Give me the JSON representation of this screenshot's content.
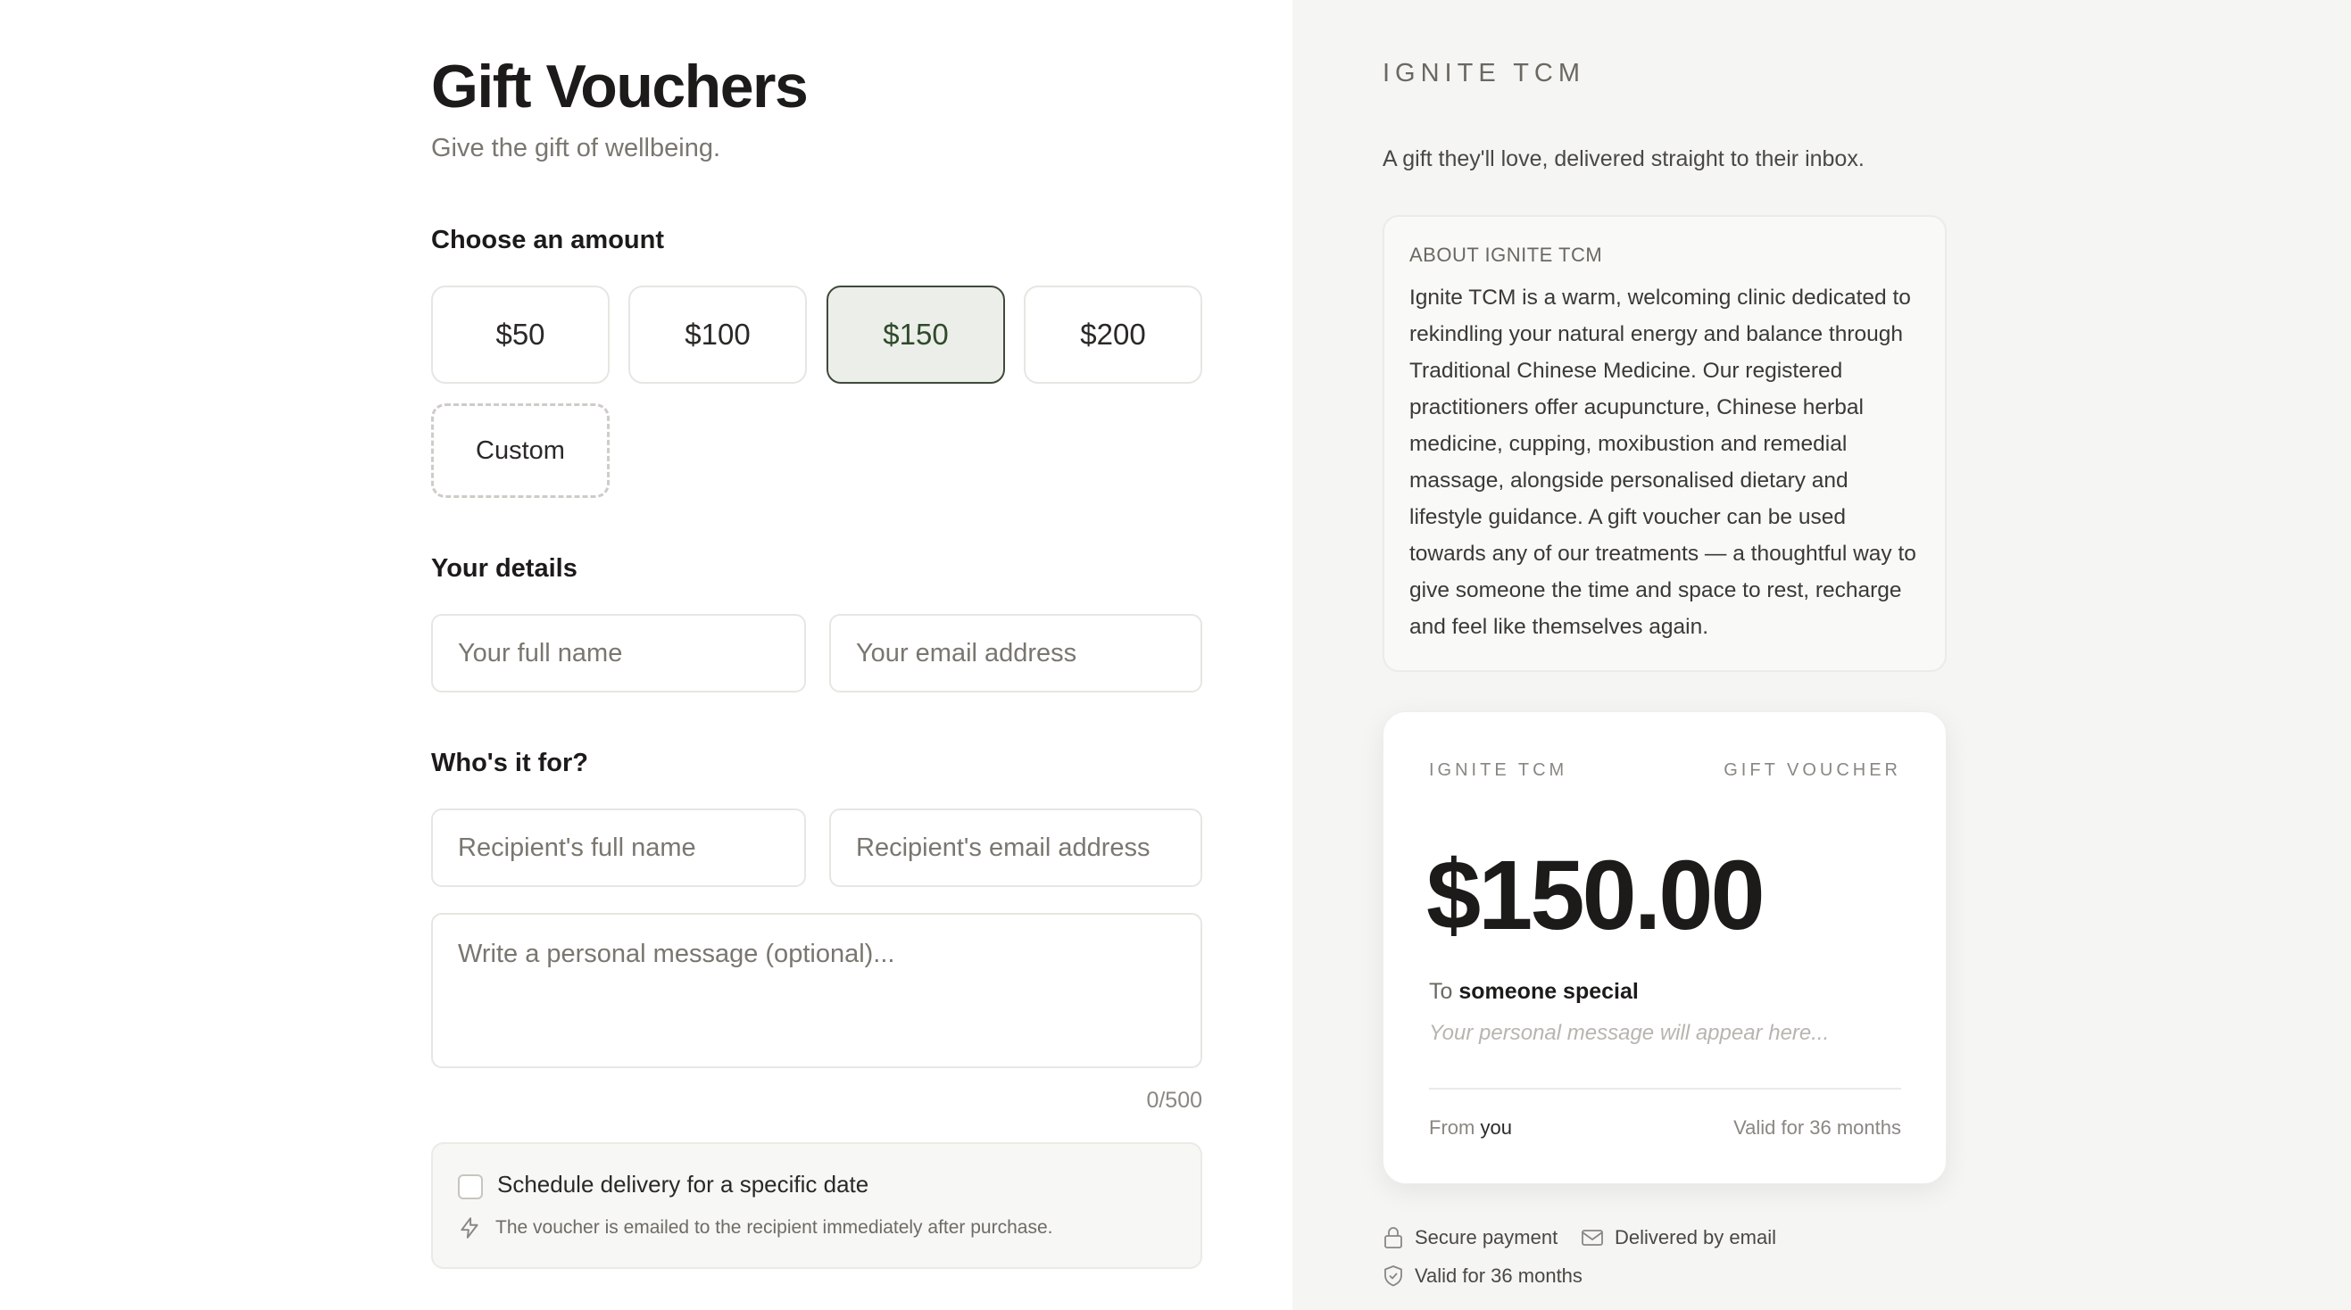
{
  "form": {
    "title": "Gift Vouchers",
    "subtitle": "Give the gift of wellbeing.",
    "amount_heading": "Choose an amount",
    "amounts": [
      "$50",
      "$100",
      "$150",
      "$200"
    ],
    "selected_amount": "$150",
    "custom_label": "Custom",
    "details_heading": "Your details",
    "your_name_placeholder": "Your full name",
    "your_email_placeholder": "Your email address",
    "recipient_heading": "Who's it for?",
    "recipient_name_placeholder": "Recipient's full name",
    "recipient_email_placeholder": "Recipient's email address",
    "message_placeholder": "Write a personal message (optional)...",
    "message_counter": "0/500",
    "schedule_label": "Schedule delivery for a specific date",
    "schedule_checked": false,
    "schedule_note": "The voucher is emailed to the recipient immediately after purchase."
  },
  "sidebar": {
    "brand": "IGNITE TCM",
    "tagline": "A gift they'll love, delivered straight to their inbox.",
    "about_heading": "ABOUT IGNITE TCM",
    "about_text": "Ignite TCM is a warm, welcoming clinic dedicated to rekindling your natural energy and balance through Traditional Chinese Medicine. Our registered practitioners offer acupuncture, Chinese herbal medicine, cupping, moxibustion and remedial massage, alongside personalised dietary and lifestyle guidance. A gift voucher can be used towards any of our treatments — a thoughtful way to give someone the time and space to rest, recharge and feel like themselves again."
  },
  "voucher": {
    "brand": "IGNITE TCM",
    "type": "GIFT VOUCHER",
    "amount": "$150.00",
    "to_prefix": "To",
    "to_name": "someone special",
    "message": "Your personal message will appear here...",
    "from_prefix": "From",
    "from_name": "you",
    "validity": "Valid for 36 months"
  },
  "features": {
    "secure": "Secure payment",
    "delivered": "Delivered by email",
    "valid": "Valid for 36 months"
  },
  "colors": {
    "accent": "#3f4a3b",
    "selected_bg": "#ecefe9",
    "panel_bg": "#f5f5f3"
  }
}
